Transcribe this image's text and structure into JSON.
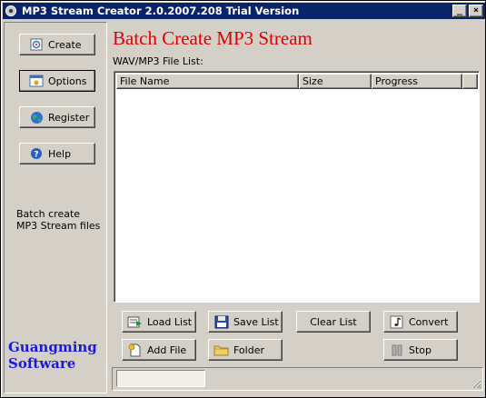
{
  "window": {
    "title": "MP3 Stream Creator 2.0.2007.208 Trial Version",
    "minimize_glyph": "_",
    "close_glyph": "×"
  },
  "sidebar": {
    "items": [
      {
        "label": "Create",
        "icon": "create-icon"
      },
      {
        "label": "Options",
        "icon": "options-icon"
      },
      {
        "label": "Register",
        "icon": "globe-icon"
      },
      {
        "label": "Help",
        "icon": "help-icon"
      }
    ],
    "description": "Batch create MP3 Stream files",
    "brand_line1": "Guangming",
    "brand_line2": "Software"
  },
  "main": {
    "heading": "Batch Create MP3 Stream",
    "list_label": "WAV/MP3 File List:",
    "columns": [
      "File Name",
      "Size",
      "Progress"
    ]
  },
  "buttons": {
    "load_list": "Load List",
    "save_list": "Save List",
    "clear_list": "Clear List",
    "convert": "Convert",
    "add_file": "Add File",
    "folder": "Folder",
    "stop": "Stop"
  },
  "colors": {
    "heading": "#e00000",
    "brand": "#1a1ad8",
    "titlebar": "#0a246a"
  }
}
